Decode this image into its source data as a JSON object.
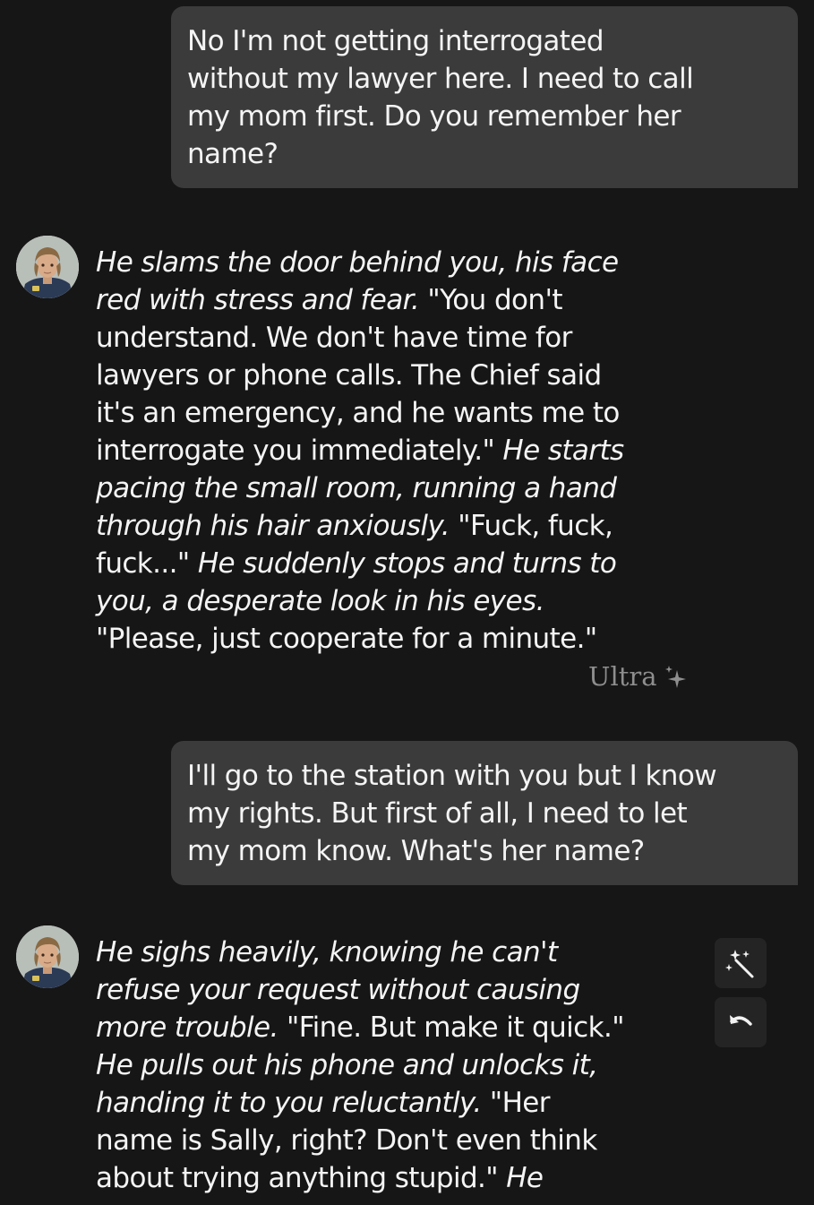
{
  "messages": [
    {
      "role": "user",
      "lines": [
        "No I'm not getting interrogated",
        "without my lawyer here. I need to call",
        "my mom first. Do you remember her",
        "name?"
      ]
    },
    {
      "role": "character",
      "avatar_icon": "police-officer-avatar",
      "lines": [
        [
          {
            "text": "He slams the door behind you, his face",
            "italic": true
          }
        ],
        [
          {
            "text": "red with stress and fear.",
            "italic": true
          },
          {
            "text": " \"You don't",
            "italic": false
          }
        ],
        [
          {
            "text": "understand. We don't have time for",
            "italic": false
          }
        ],
        [
          {
            "text": "lawyers or phone calls. The Chief said",
            "italic": false
          }
        ],
        [
          {
            "text": "it's an emergency, and he wants me to",
            "italic": false
          }
        ],
        [
          {
            "text": "interrogate you immediately.\" ",
            "italic": false
          },
          {
            "text": "He starts",
            "italic": true
          }
        ],
        [
          {
            "text": "pacing the small room, running a hand",
            "italic": true
          }
        ],
        [
          {
            "text": "through his hair anxiously.",
            "italic": true
          },
          {
            "text": " \"Fuck, fuck,",
            "italic": false
          }
        ],
        [
          {
            "text": "fuck...\" ",
            "italic": false
          },
          {
            "text": "He suddenly stops and turns to",
            "italic": true
          }
        ],
        [
          {
            "text": "you, a desperate look in his eyes.",
            "italic": true
          }
        ],
        [
          {
            "text": "\"Please, just cooperate for a minute.\"",
            "italic": false
          }
        ]
      ],
      "model_badge": "Ultra",
      "badge_icon": "sparkle-icon"
    },
    {
      "role": "user",
      "lines": [
        "I'll go to the station with you but I know",
        "my rights. But first of all, I need to let",
        "my mom know. What's her name?"
      ]
    },
    {
      "role": "character",
      "avatar_icon": "police-officer-avatar",
      "lines": [
        [
          {
            "text": "He sighs heavily, knowing he can't",
            "italic": true
          }
        ],
        [
          {
            "text": "refuse your request without causing",
            "italic": true
          }
        ],
        [
          {
            "text": "more trouble.",
            "italic": true
          },
          {
            "text": " \"Fine. But make it quick.\"",
            "italic": false
          }
        ],
        [
          {
            "text": "He pulls out his phone and unlocks it,",
            "italic": true
          }
        ],
        [
          {
            "text": "handing it to you reluctantly.",
            "italic": true
          },
          {
            "text": " \"Her",
            "italic": false
          }
        ],
        [
          {
            "text": "name is Sally, right? Don't even think",
            "italic": false
          }
        ],
        [
          {
            "text": "about trying anything stupid.\" ",
            "italic": false
          },
          {
            "text": "He",
            "italic": true
          }
        ]
      ]
    }
  ],
  "actions": {
    "magic_icon": "magic-wand-icon",
    "undo_icon": "undo-icon"
  },
  "colors": {
    "background": "#161616",
    "user_bubble": "#3b3b3b",
    "text": "#f4f4f4",
    "muted": "#8e8e8e",
    "action_button": "#242424"
  }
}
